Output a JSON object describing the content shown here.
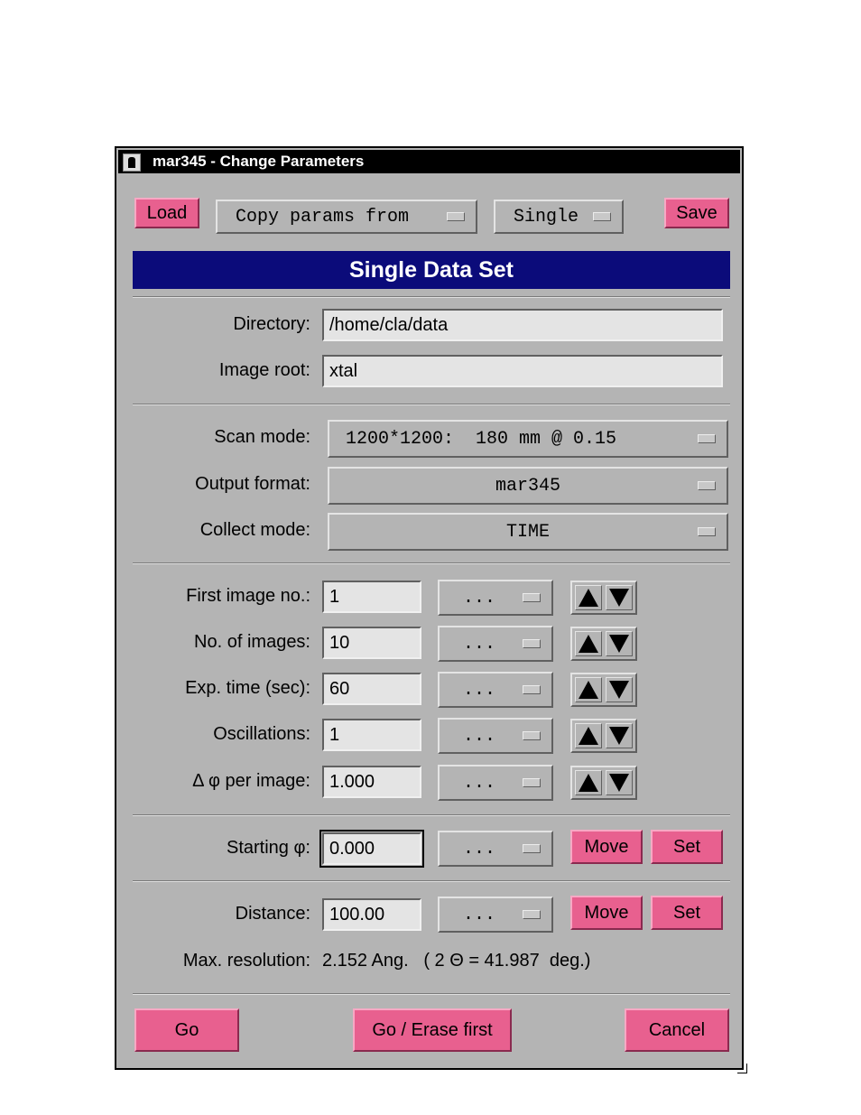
{
  "window": {
    "title": "mar345 - Change Parameters"
  },
  "toolbar": {
    "load_label": "Load",
    "copy_params_label": "Copy params from",
    "mode_label": "Single",
    "save_label": "Save"
  },
  "banner": "Single Data Set",
  "paths": {
    "directory_label": "Directory:",
    "directory_value": "/home/cla/data",
    "image_root_label": "Image root:",
    "image_root_value": "xtal"
  },
  "modes": {
    "scan_mode_label": "Scan mode:",
    "scan_mode_value": "1200*1200:  180 mm @ 0.15",
    "output_format_label": "Output format:",
    "output_format_value": "mar345",
    "collect_mode_label": "Collect mode:",
    "collect_mode_value": "TIME"
  },
  "images": {
    "rows": [
      {
        "label": "First image no.:",
        "value": "1",
        "menu": "..."
      },
      {
        "label": "No. of images:",
        "value": "10",
        "menu": "..."
      },
      {
        "label": "Exp. time (sec):",
        "value": "60",
        "menu": "..."
      },
      {
        "label": "Oscillations:",
        "value": "1",
        "menu": "..."
      },
      {
        "label": "Δ φ per image:",
        "value": "1.000",
        "menu": "..."
      }
    ]
  },
  "phi": {
    "label": "Starting φ:",
    "value": "0.000",
    "menu": "...",
    "move_label": "Move",
    "set_label": "Set"
  },
  "distance": {
    "label": "Distance:",
    "value": "100.00",
    "menu": "...",
    "move_label": "Move",
    "set_label": "Set",
    "max_res_label": "Max. resolution:",
    "max_res_value": "2.152 Ang.   ( 2 Θ = 41.987  deg.)"
  },
  "footer": {
    "go_label": "Go",
    "go_erase_label": "Go / Erase first",
    "cancel_label": "Cancel"
  },
  "colors": {
    "window_bg": "#b4b4b4",
    "banner_bg": "#0b0b7a",
    "pink_button": "#e8608f"
  }
}
